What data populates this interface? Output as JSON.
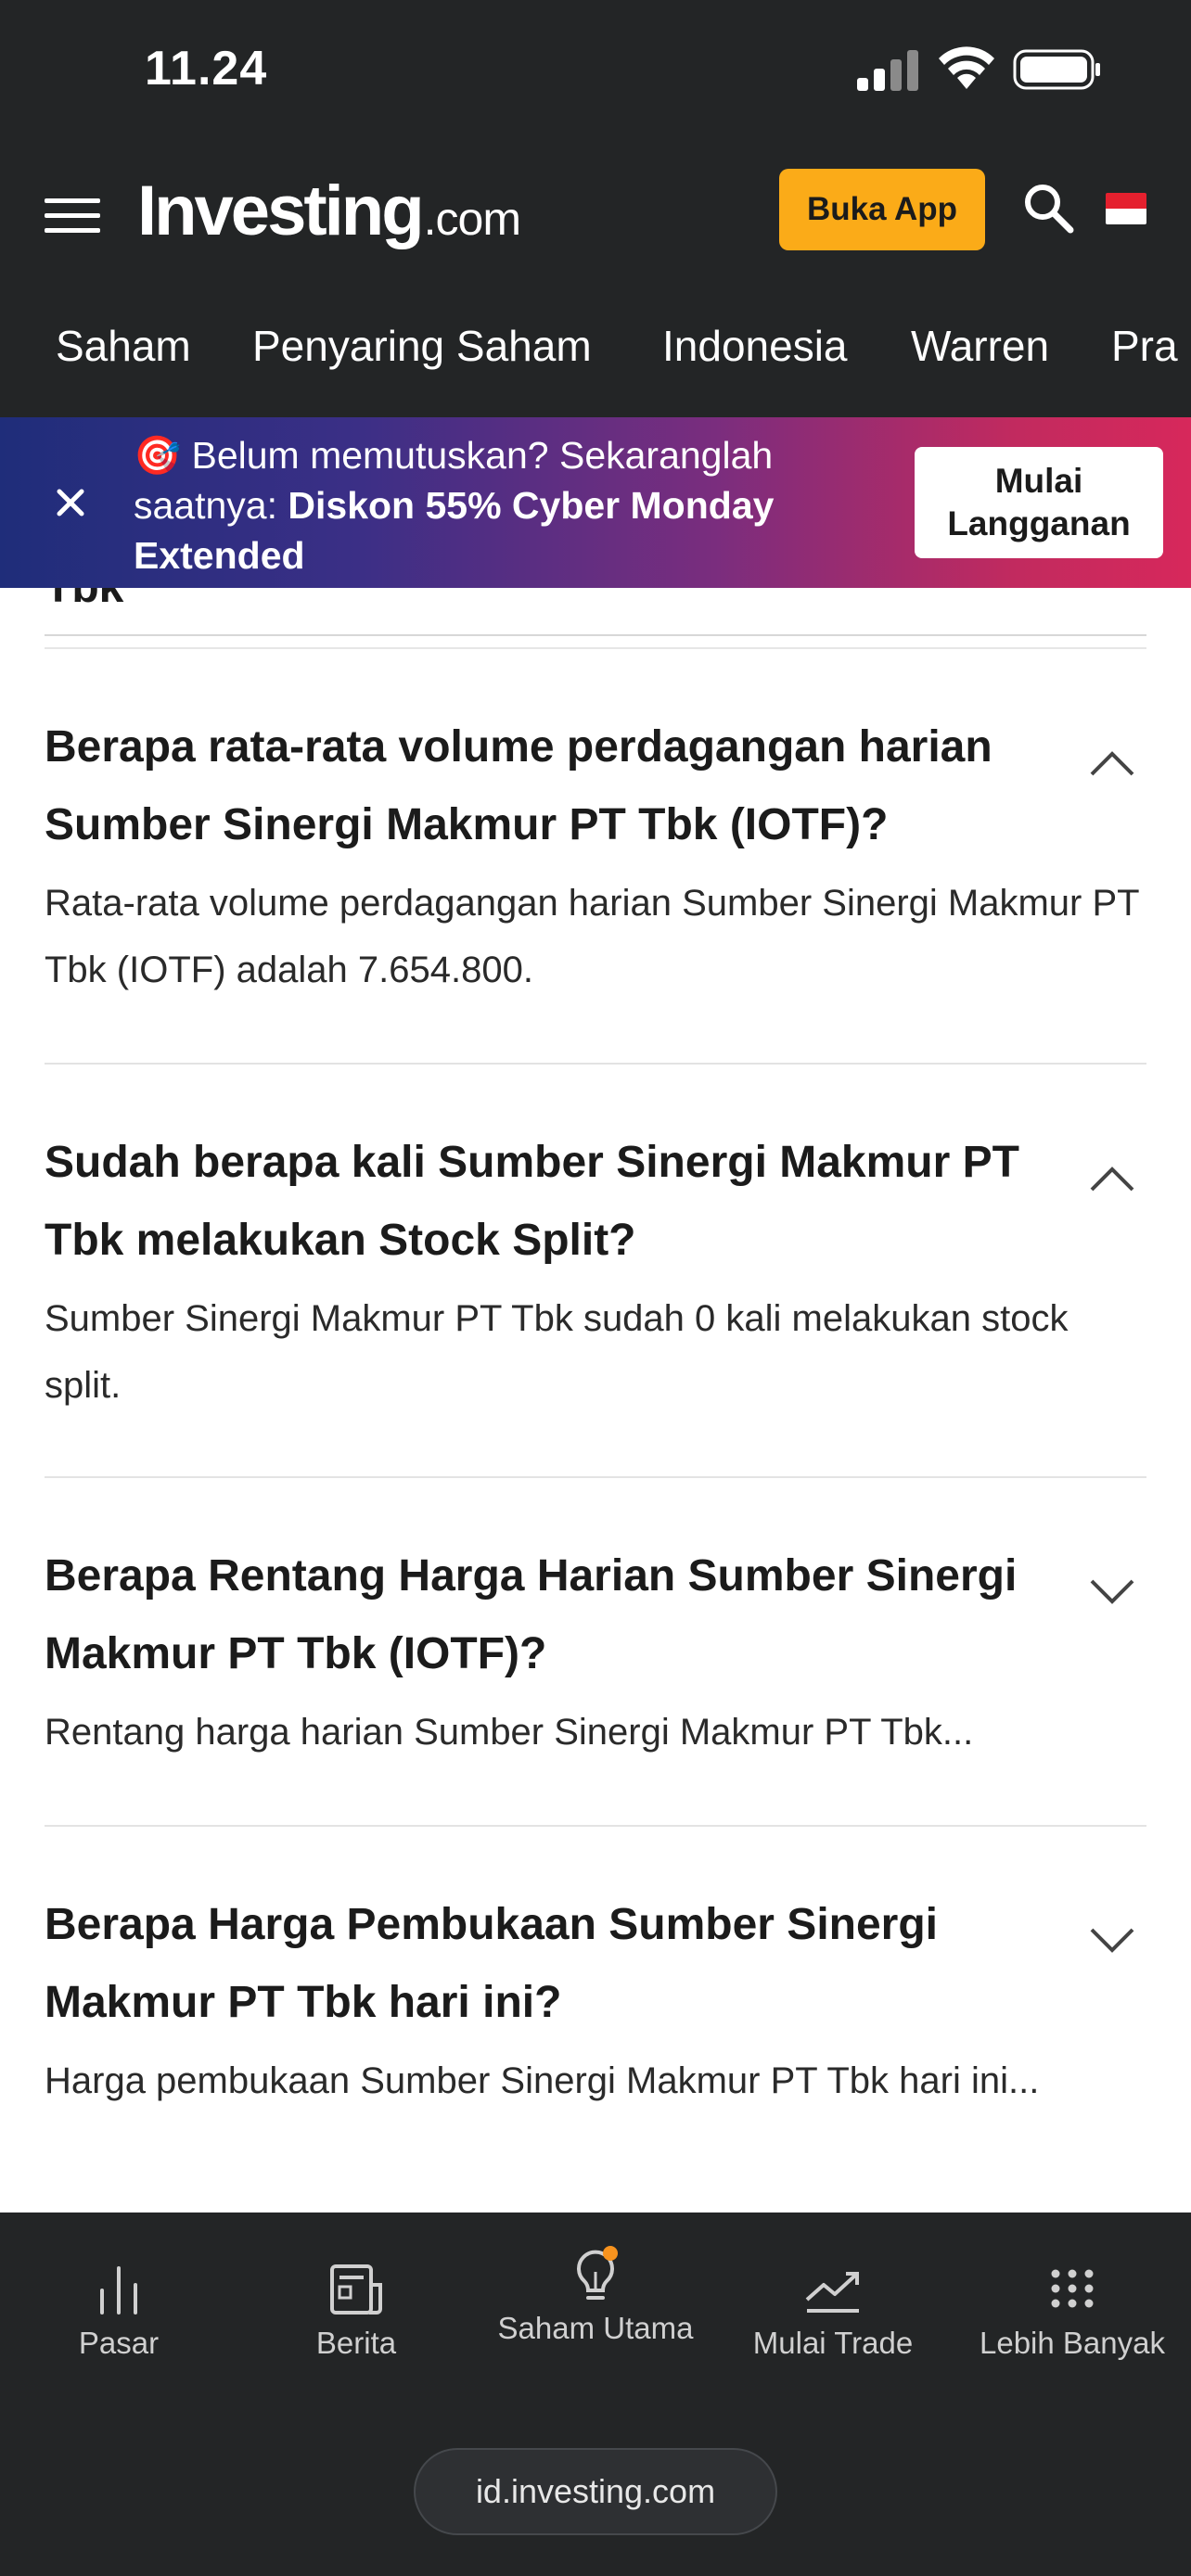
{
  "status_bar": {
    "time": "11.24",
    "icons": [
      "signal-icon",
      "wifi-icon",
      "battery-icon"
    ]
  },
  "header": {
    "logo_main": "Investing",
    "logo_suffix": ".com",
    "open_app_label": "Buka App",
    "icons": [
      "menu-icon",
      "search-icon",
      "indonesia-flag-icon"
    ],
    "accent_color": "#fbab18",
    "nav_tabs": [
      {
        "label": "Saham"
      },
      {
        "label": "Penyaring Saham"
      },
      {
        "label": "Indonesia"
      },
      {
        "label": "Warren"
      },
      {
        "label": "Pra"
      }
    ]
  },
  "promo": {
    "emoji": "🎯",
    "text_prefix": "Belum memutuskan? Sekaranglah saatnya: ",
    "text_bold": "Diskon 55% Cyber Monday Extended",
    "button_label": "Mulai Langganan",
    "close_icon": "close-icon"
  },
  "content": {
    "clipped_heading": "Tbk",
    "faqs": [
      {
        "question": "Berapa rata-rata volume perdagangan harian Sumber Sinergi Makmur PT Tbk (IOTF)?",
        "answer": "Rata-rata volume perdagangan harian Sumber Sinergi Makmur PT Tbk (IOTF) adalah 7.654.800.",
        "expanded": true
      },
      {
        "question": "Sudah berapa kali Sumber Sinergi Makmur PT Tbk melakukan Stock Split?",
        "answer": "Sumber Sinergi Makmur PT Tbk sudah 0 kali melakukan stock split.",
        "expanded": true
      },
      {
        "question": "Berapa Rentang Harga Harian Sumber Sinergi Makmur PT Tbk (IOTF)?",
        "answer": "Rentang harga harian Sumber Sinergi Makmur PT Tbk...",
        "expanded": false
      },
      {
        "question": "Berapa Harga Pembukaan Sumber Sinergi Makmur PT Tbk hari ini?",
        "answer": "Harga pembukaan Sumber Sinergi Makmur PT Tbk hari ini...",
        "expanded": false
      }
    ]
  },
  "bottom_nav": {
    "items": [
      {
        "label": "Pasar",
        "icon": "bar-chart-icon"
      },
      {
        "label": "Berita",
        "icon": "news-icon"
      },
      {
        "label": "Saham Utama",
        "icon": "lightbulb-icon"
      },
      {
        "label": "Mulai Trade",
        "icon": "trend-up-icon"
      },
      {
        "label": "Lebih Banyak",
        "icon": "grid-dots-icon"
      }
    ],
    "notification_dot_color": "#f7931e"
  },
  "browser": {
    "url": "id.investing.com"
  }
}
